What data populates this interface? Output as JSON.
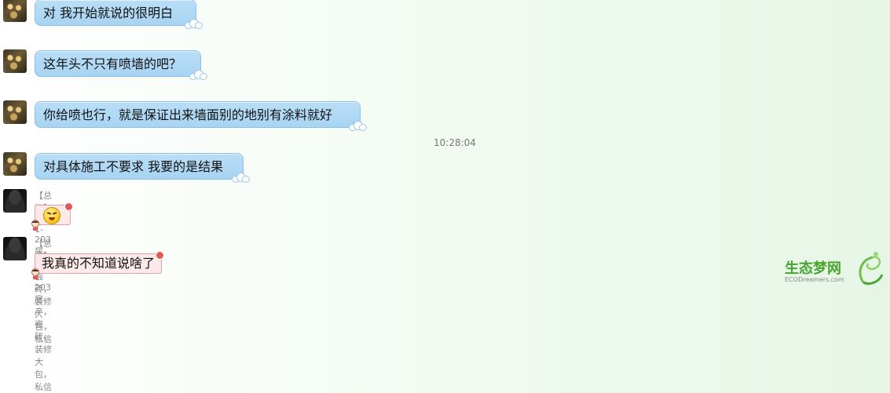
{
  "messages": [
    {
      "text": "对 我开始就说的很明白"
    },
    {
      "text": "这年头不只有喷墙的吧？"
    },
    {
      "text": "你给喷也行，就是保证出来墙面别的地别有涂料就好"
    },
    {
      "text": "对具体施工不要求 我要的是结果"
    }
  ],
  "timestamp": "10:28:04",
  "other_messages": [
    {
      "sender": "【总监】47-1-203房产，瓷砖，装修大包，私信",
      "content_type": "emoji",
      "emoji_name": "grin-sweat-emoji"
    },
    {
      "sender": "【总监】47-1-203房产，瓷砖，装修大包，私信",
      "content_type": "text",
      "text": "我真的不知道说啥了"
    }
  ],
  "logo": {
    "line1": "生态梦网",
    "line2": "ECODreamers.com"
  },
  "colors": {
    "bubble": "#a8d4f2",
    "pink_bubble": "#fde9e9",
    "logo_green": "#44a62d"
  }
}
